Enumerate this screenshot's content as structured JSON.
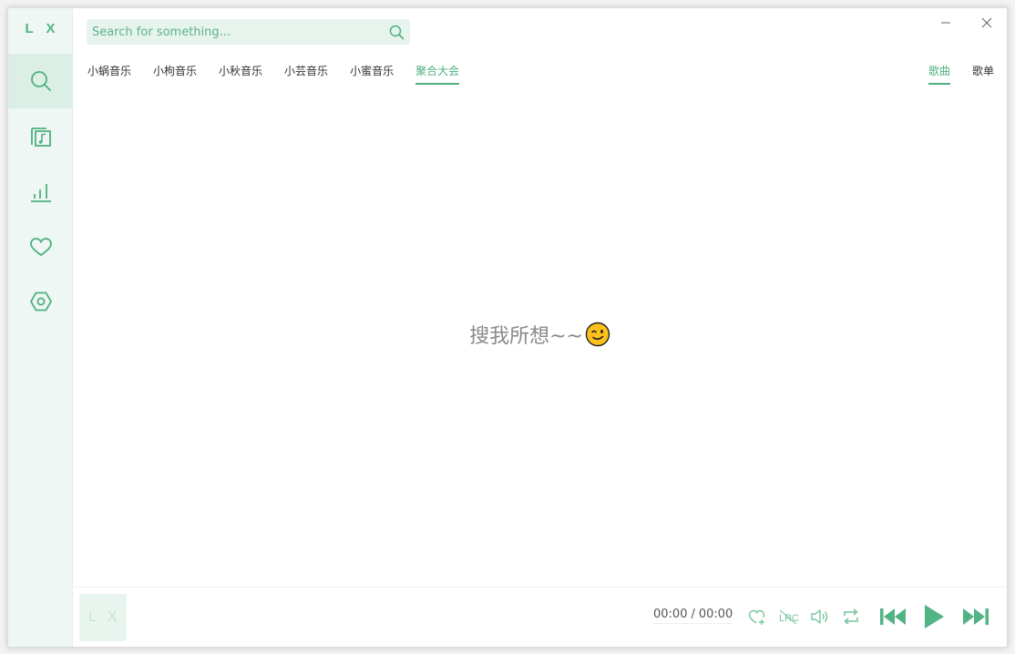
{
  "app": {
    "logo": "L X"
  },
  "colors": {
    "accent": "#4fb07f",
    "sidebar_bg": "#eef7f3",
    "active_bg": "#dcefe6"
  },
  "sidebar": {
    "items": [
      {
        "icon": "search-icon",
        "active": true
      },
      {
        "icon": "music-library-icon",
        "active": false
      },
      {
        "icon": "chart-icon",
        "active": false
      },
      {
        "icon": "heart-icon",
        "active": false
      },
      {
        "icon": "settings-icon",
        "active": false
      }
    ]
  },
  "search": {
    "placeholder": "Search for something...",
    "value": ""
  },
  "source_tabs": [
    {
      "label": "小蜗音乐",
      "active": false
    },
    {
      "label": "小枸音乐",
      "active": false
    },
    {
      "label": "小秋音乐",
      "active": false
    },
    {
      "label": "小芸音乐",
      "active": false
    },
    {
      "label": "小蜜音乐",
      "active": false
    },
    {
      "label": "聚合大会",
      "active": true
    }
  ],
  "type_tabs": [
    {
      "label": "歌曲",
      "active": true
    },
    {
      "label": "歌单",
      "active": false
    }
  ],
  "main": {
    "empty_message": "搜我所想~~"
  },
  "player": {
    "cover_text": "L X",
    "current_time": "00:00",
    "time_separator": "/",
    "total_time": "00:00"
  }
}
